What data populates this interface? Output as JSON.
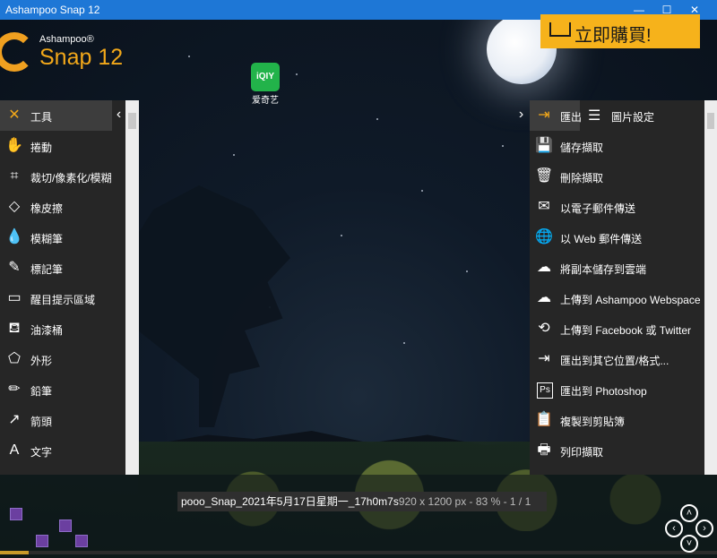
{
  "window": {
    "title": "Ashampoo Snap 12",
    "min_glyph": "—",
    "max_glyph": "☐",
    "close_glyph": "✕"
  },
  "logo": {
    "brand": "Ashampoo®",
    "product": "Snap 12"
  },
  "buy_button": {
    "label": "立即購買!"
  },
  "desktop_icon": {
    "glyph": "iQIY",
    "label": "爱奇艺"
  },
  "left_panel": {
    "collapse_glyph": "‹",
    "items": [
      {
        "label": "工具",
        "icon": "tools-icon",
        "glyph": "✕"
      },
      {
        "label": "捲動",
        "icon": "hand-icon",
        "glyph": "✋"
      },
      {
        "label": "裁切/像素化/模糊",
        "icon": "crop-icon",
        "glyph": "⌗"
      },
      {
        "label": "橡皮擦",
        "icon": "eraser-icon",
        "glyph": "◇"
      },
      {
        "label": "模糊筆",
        "icon": "blur-drop-icon",
        "glyph": "💧"
      },
      {
        "label": "標記筆",
        "icon": "marker-icon",
        "glyph": "✎"
      },
      {
        "label": "醒目提示區域",
        "icon": "highlight-region-icon",
        "glyph": "▭"
      },
      {
        "label": "油漆桶",
        "icon": "paint-bucket-icon",
        "glyph": "⛾"
      },
      {
        "label": "外形",
        "icon": "pentagon-icon",
        "glyph": "⬠"
      },
      {
        "label": "鉛筆",
        "icon": "pencil-icon",
        "glyph": "✏"
      },
      {
        "label": "箭頭",
        "icon": "arrow-icon",
        "glyph": "↗"
      },
      {
        "label": "文字",
        "icon": "text-icon",
        "glyph": "A"
      }
    ]
  },
  "right_panel": {
    "collapse_glyph": "›",
    "export": {
      "label": "匯出",
      "glyph": "⇥"
    },
    "image_settings": {
      "label": "圖片設定",
      "glyph": "☰"
    },
    "items": [
      {
        "label": "儲存擷取",
        "icon": "save-icon",
        "glyph": "💾"
      },
      {
        "label": "刪除擷取",
        "icon": "trash-icon",
        "glyph": "🗑"
      },
      {
        "label": "以電子郵件傳送",
        "icon": "email-icon",
        "glyph": "✉"
      },
      {
        "label": "以 Web 郵件傳送",
        "icon": "globe-icon",
        "glyph": "🌐"
      },
      {
        "label": "將副本儲存到雲端",
        "icon": "cloud-upload-icon",
        "glyph": "☁"
      },
      {
        "label": "上傳到 Ashampoo Webspace",
        "icon": "cloud-webspace-icon",
        "glyph": "☁"
      },
      {
        "label": "上傳到  Facebook 或 Twitter",
        "icon": "share-icon",
        "glyph": "⟲"
      },
      {
        "label": "匯出到其它位置/格式...",
        "icon": "export-other-icon",
        "glyph": "⇥"
      },
      {
        "label": "匯出到 Photoshop",
        "icon": "photoshop-icon",
        "glyph": "Ps"
      },
      {
        "label": "複製到剪貼簿",
        "icon": "clipboard-icon",
        "glyph": "📋"
      },
      {
        "label": "列印擷取",
        "icon": "printer-icon",
        "glyph": "🖶"
      }
    ]
  },
  "status": {
    "filename": "pooo_Snap_2021年5月17日星期一_17h0m7s",
    "info": "920 x 1200 px - 83 % - 1 / 1"
  },
  "progress": {
    "value": 0.04
  },
  "nav_pad": {
    "up": "˄",
    "down": "˅",
    "left": "‹",
    "right": "›"
  },
  "colors": {
    "accent": "#f2a81a",
    "titlebar": "#1e77d6",
    "panel": "#262626"
  }
}
